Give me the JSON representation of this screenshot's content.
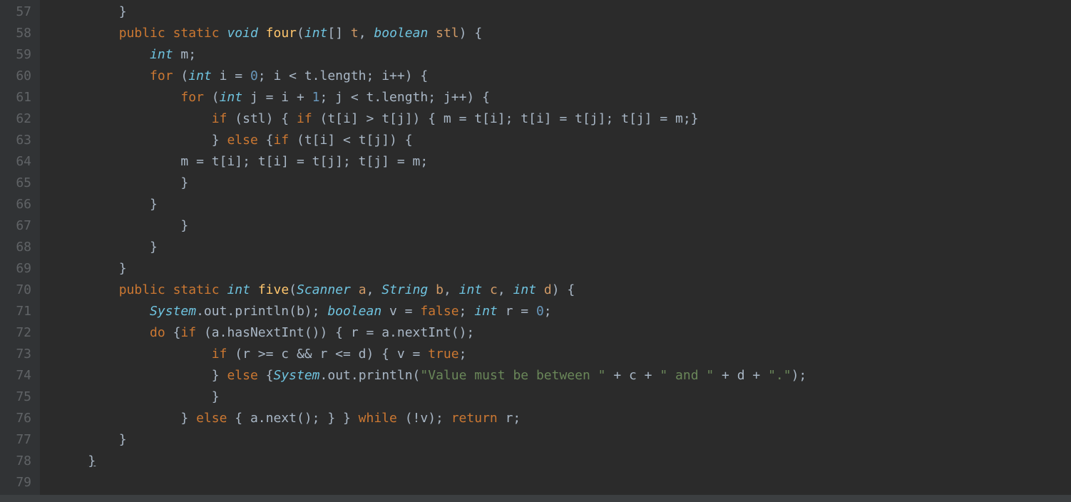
{
  "gutter": {
    "start": 57,
    "end": 79
  },
  "code": {
    "lines": [
      {
        "indent": 8,
        "tokens": [
          {
            "t": "}",
            "c": "punct"
          }
        ]
      },
      {
        "indent": 8,
        "tokens": [
          {
            "t": "public",
            "c": "kw-pub"
          },
          {
            "t": " ",
            "c": ""
          },
          {
            "t": "static",
            "c": "kw-pub"
          },
          {
            "t": " ",
            "c": ""
          },
          {
            "t": "void",
            "c": "kw-type"
          },
          {
            "t": " ",
            "c": ""
          },
          {
            "t": "four",
            "c": "method"
          },
          {
            "t": "(",
            "c": "punct"
          },
          {
            "t": "int",
            "c": "kw-type"
          },
          {
            "t": "[] ",
            "c": "punct"
          },
          {
            "t": "t",
            "c": "param"
          },
          {
            "t": ", ",
            "c": "punct"
          },
          {
            "t": "boolean",
            "c": "kw-type"
          },
          {
            "t": " ",
            "c": ""
          },
          {
            "t": "stl",
            "c": "param"
          },
          {
            "t": ") {",
            "c": "punct"
          }
        ]
      },
      {
        "indent": 12,
        "tokens": [
          {
            "t": "int",
            "c": "kw-type"
          },
          {
            "t": " m;",
            "c": "punct"
          }
        ]
      },
      {
        "indent": 12,
        "tokens": [
          {
            "t": "for",
            "c": "kw-ctrl"
          },
          {
            "t": " (",
            "c": "punct"
          },
          {
            "t": "int",
            "c": "kw-type"
          },
          {
            "t": " i = ",
            "c": "punct"
          },
          {
            "t": "0",
            "c": "num"
          },
          {
            "t": "; i < t.length; i++) {",
            "c": "punct"
          }
        ]
      },
      {
        "indent": 16,
        "tokens": [
          {
            "t": "for",
            "c": "kw-ctrl"
          },
          {
            "t": " (",
            "c": "punct"
          },
          {
            "t": "int",
            "c": "kw-type"
          },
          {
            "t": " j = i + ",
            "c": "punct"
          },
          {
            "t": "1",
            "c": "num"
          },
          {
            "t": "; j < t.length; j++) {",
            "c": "punct"
          }
        ]
      },
      {
        "indent": 20,
        "tokens": [
          {
            "t": "if",
            "c": "kw-ctrl"
          },
          {
            "t": " (stl) { ",
            "c": "punct"
          },
          {
            "t": "if",
            "c": "kw-ctrl"
          },
          {
            "t": " (t[i] > t[j]) { m = t[i]; t[i] = t[j]; t[j] = m;}",
            "c": "punct"
          }
        ]
      },
      {
        "indent": 20,
        "tokens": [
          {
            "t": "} ",
            "c": "punct"
          },
          {
            "t": "else",
            "c": "kw-ctrl"
          },
          {
            "t": " {",
            "c": "punct"
          },
          {
            "t": "if",
            "c": "kw-ctrl"
          },
          {
            "t": " (t[i] < t[j]) {",
            "c": "punct"
          }
        ]
      },
      {
        "indent": 16,
        "tokens": [
          {
            "t": "m = t[i]; t[i] = t[j]; t[j] = m;",
            "c": "punct"
          }
        ]
      },
      {
        "indent": 16,
        "tokens": [
          {
            "t": "}",
            "c": "punct"
          }
        ]
      },
      {
        "indent": 12,
        "tokens": [
          {
            "t": "}",
            "c": "punct"
          }
        ]
      },
      {
        "indent": 16,
        "tokens": [
          {
            "t": "}",
            "c": "punct"
          }
        ]
      },
      {
        "indent": 12,
        "tokens": [
          {
            "t": "}",
            "c": "punct"
          }
        ]
      },
      {
        "indent": 8,
        "tokens": [
          {
            "t": "}",
            "c": "punct"
          }
        ]
      },
      {
        "indent": 8,
        "tokens": [
          {
            "t": "public",
            "c": "kw-pub"
          },
          {
            "t": " ",
            "c": ""
          },
          {
            "t": "static",
            "c": "kw-pub"
          },
          {
            "t": " ",
            "c": ""
          },
          {
            "t": "int",
            "c": "kw-type"
          },
          {
            "t": " ",
            "c": ""
          },
          {
            "t": "five",
            "c": "method"
          },
          {
            "t": "(",
            "c": "punct"
          },
          {
            "t": "Scanner",
            "c": "kw-type"
          },
          {
            "t": " ",
            "c": ""
          },
          {
            "t": "a",
            "c": "param"
          },
          {
            "t": ", ",
            "c": "punct"
          },
          {
            "t": "String",
            "c": "kw-type"
          },
          {
            "t": " ",
            "c": ""
          },
          {
            "t": "b",
            "c": "param"
          },
          {
            "t": ", ",
            "c": "punct"
          },
          {
            "t": "int",
            "c": "kw-type"
          },
          {
            "t": " ",
            "c": ""
          },
          {
            "t": "c",
            "c": "param"
          },
          {
            "t": ", ",
            "c": "punct"
          },
          {
            "t": "int",
            "c": "kw-type"
          },
          {
            "t": " ",
            "c": ""
          },
          {
            "t": "d",
            "c": "param"
          },
          {
            "t": ") {",
            "c": "punct"
          }
        ]
      },
      {
        "indent": 12,
        "tokens": [
          {
            "t": "System",
            "c": "kw-type"
          },
          {
            "t": ".out.println(b); ",
            "c": "punct"
          },
          {
            "t": "boolean",
            "c": "kw-type"
          },
          {
            "t": " v = ",
            "c": "punct"
          },
          {
            "t": "false",
            "c": "bool"
          },
          {
            "t": "; ",
            "c": "punct"
          },
          {
            "t": "int",
            "c": "kw-type"
          },
          {
            "t": " r = ",
            "c": "punct"
          },
          {
            "t": "0",
            "c": "num"
          },
          {
            "t": ";",
            "c": "punct"
          }
        ]
      },
      {
        "indent": 12,
        "tokens": [
          {
            "t": "do",
            "c": "kw-ctrl"
          },
          {
            "t": " {",
            "c": "punct"
          },
          {
            "t": "if",
            "c": "kw-ctrl"
          },
          {
            "t": " (a.hasNextInt()) { r = a.nextInt();",
            "c": "punct"
          }
        ]
      },
      {
        "indent": 20,
        "tokens": [
          {
            "t": "if",
            "c": "kw-ctrl"
          },
          {
            "t": " (r >= c && r <= d) { v = ",
            "c": "punct"
          },
          {
            "t": "true",
            "c": "bool"
          },
          {
            "t": ";",
            "c": "punct"
          }
        ]
      },
      {
        "indent": 20,
        "tokens": [
          {
            "t": "} ",
            "c": "punct"
          },
          {
            "t": "else",
            "c": "kw-ctrl"
          },
          {
            "t": " {",
            "c": "punct"
          },
          {
            "t": "System",
            "c": "kw-type"
          },
          {
            "t": ".out.println(",
            "c": "punct"
          },
          {
            "t": "\"Value must be between \"",
            "c": "str"
          },
          {
            "t": " + c + ",
            "c": "punct"
          },
          {
            "t": "\" and \"",
            "c": "str"
          },
          {
            "t": " + d + ",
            "c": "punct"
          },
          {
            "t": "\".\"",
            "c": "str"
          },
          {
            "t": ");",
            "c": "punct"
          }
        ]
      },
      {
        "indent": 20,
        "tokens": [
          {
            "t": "}",
            "c": "punct"
          }
        ]
      },
      {
        "indent": 16,
        "tokens": [
          {
            "t": "} ",
            "c": "punct"
          },
          {
            "t": "else",
            "c": "kw-ctrl"
          },
          {
            "t": " { a.next(); } } ",
            "c": "punct"
          },
          {
            "t": "while",
            "c": "kw-ctrl"
          },
          {
            "t": " (!v); ",
            "c": "punct"
          },
          {
            "t": "return",
            "c": "kw-ctrl"
          },
          {
            "t": " r;",
            "c": "punct"
          }
        ]
      },
      {
        "indent": 8,
        "tokens": [
          {
            "t": "}",
            "c": "punct"
          }
        ]
      },
      {
        "indent": 4,
        "tokens": [
          {
            "t": "}",
            "c": "punct",
            "underline": true
          }
        ]
      },
      {
        "indent": 0,
        "tokens": []
      }
    ]
  }
}
